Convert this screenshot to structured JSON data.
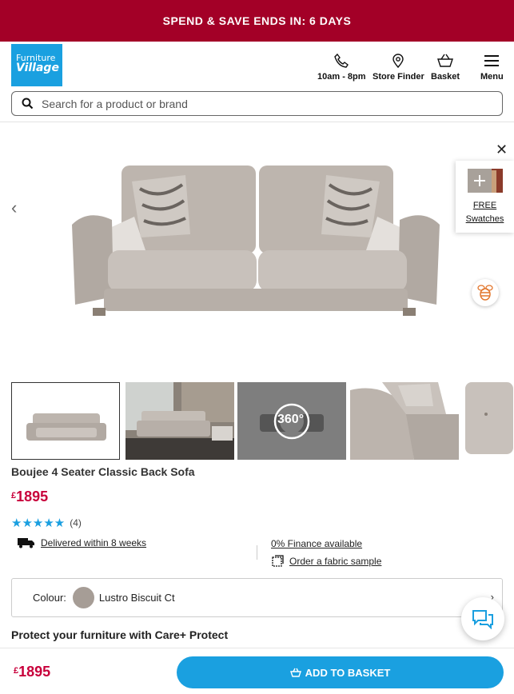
{
  "promo": {
    "text": "SPEND & SAVE ENDS IN: 6 DAYS"
  },
  "header": {
    "logo_line1": "Furniture",
    "logo_line2": "Village",
    "hours": "10am - 8pm",
    "store_finder": "Store Finder",
    "basket": "Basket",
    "menu": "Menu"
  },
  "search": {
    "placeholder": "Search for a product or brand"
  },
  "hero": {
    "swatches_line1": "FREE",
    "swatches_line2": "Swatches"
  },
  "thumbnails": {
    "badge_360": "360°"
  },
  "product": {
    "title": "Boujee 4 Seater Classic Back Sofa",
    "currency": "£",
    "price": "1895",
    "stars": "★★★★★",
    "rating_count": "(4)",
    "rating_value": 5,
    "delivery": "Delivered within 8 weeks",
    "finance": "0% Finance available",
    "fabric_sample": "Order a fabric sample",
    "colour_label": "Colour:",
    "colour_value": "Lustro Biscuit Ct",
    "protect": "Protect your furniture with Care+ Protect"
  },
  "bottom_bar": {
    "currency": "£",
    "price": "1895",
    "add_label": "ADD TO BASKET"
  },
  "colors": {
    "promo_bg": "#a30027",
    "brand_blue": "#1aa0e0",
    "price_red": "#c8003b",
    "swatch_colour": "#a69d96"
  }
}
